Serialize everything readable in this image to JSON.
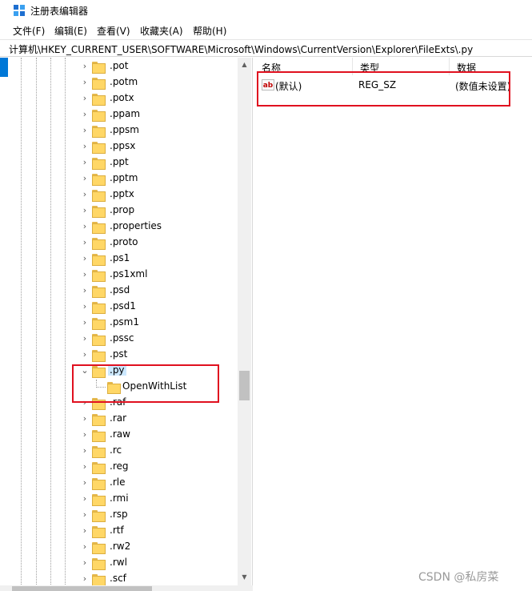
{
  "window": {
    "title": "注册表编辑器",
    "icon": "registry-editor-icon"
  },
  "menu": [
    "文件(F)",
    "编辑(E)",
    "查看(V)",
    "收藏夹(A)",
    "帮助(H)"
  ],
  "address": "计算机\\HKEY_CURRENT_USER\\SOFTWARE\\Microsoft\\Windows\\CurrentVersion\\Explorer\\FileExts\\.py",
  "tree": {
    "items": [
      ".pot",
      ".potm",
      ".potx",
      ".ppam",
      ".ppsm",
      ".ppsx",
      ".ppt",
      ".pptm",
      ".pptx",
      ".prop",
      ".properties",
      ".proto",
      ".ps1",
      ".ps1xml",
      ".psd",
      ".psd1",
      ".psm1",
      ".pssc",
      ".pst",
      ".py",
      ".raf",
      ".rar",
      ".raw",
      ".rc",
      ".reg",
      ".rle",
      ".rmi",
      ".rsp",
      ".rtf",
      ".rw2",
      ".rwl",
      ".scf"
    ],
    "expanded_item": ".py",
    "child_label": "OpenWithList"
  },
  "list": {
    "columns": [
      "名称",
      "类型",
      "数据"
    ],
    "rows": [
      {
        "name": "(默认)",
        "type": "REG_SZ",
        "data": "(数值未设置)",
        "icon": "string-value-icon"
      }
    ]
  },
  "watermark": "CSDN @私房菜",
  "colors": {
    "highlight_box": "#e0101f",
    "selection": "#cce8ff",
    "accent": "#0078d7"
  }
}
